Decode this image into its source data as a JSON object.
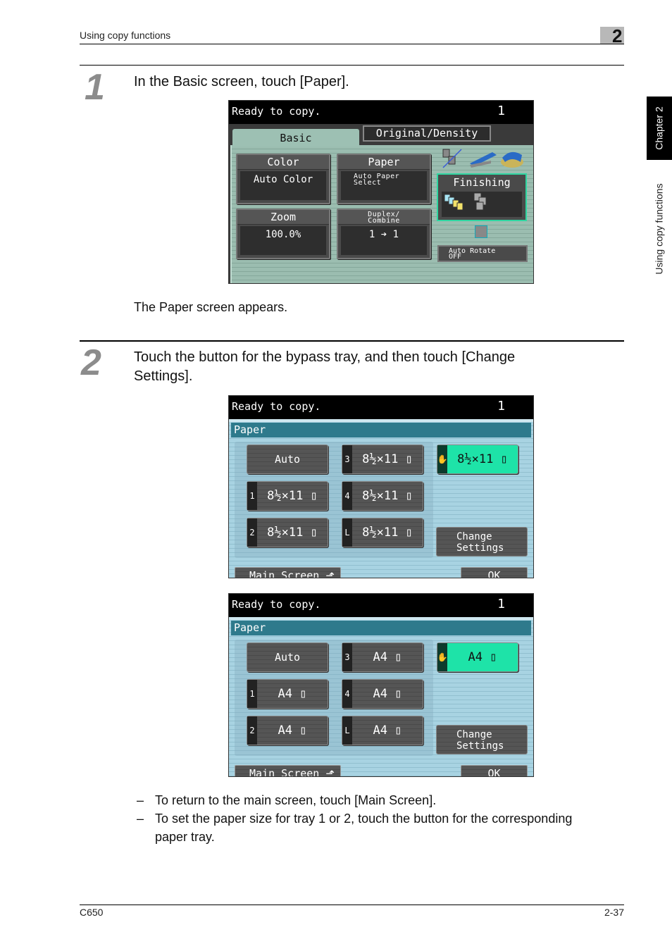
{
  "header": {
    "section_title": "Using copy functions",
    "chapter_number": "2"
  },
  "side_tab": {
    "chapter": "Chapter 2",
    "section": "Using copy functions"
  },
  "steps": [
    {
      "number": "1",
      "instruction": "In the Basic screen, touch [Paper].",
      "result": "The Paper screen appears."
    },
    {
      "number": "2",
      "instruction_line1": "Touch the button for the bypass tray, and then touch [Change",
      "instruction_line2": "Settings]."
    }
  ],
  "basic_screen": {
    "status": "Ready to copy.",
    "count": "1",
    "tabs": [
      {
        "label": "Basic",
        "active": true
      },
      {
        "label": "Original/Density",
        "active": false
      }
    ],
    "functions": [
      {
        "title": "Color",
        "value": "Auto Color"
      },
      {
        "title": "Paper",
        "value_line1": "Auto Paper",
        "value_line2": "Select"
      },
      {
        "title": "Zoom",
        "value": "100.0%"
      },
      {
        "title_line1": "Duplex/",
        "title_line2": "Combine",
        "value": "1 ➔ 1"
      }
    ],
    "finishing": {
      "title": "Finishing"
    },
    "auto_rotate": {
      "line1": "Auto Rotate",
      "line2": "OFF"
    }
  },
  "paper_screens": [
    {
      "status": "Ready to copy.",
      "count": "1",
      "title": "Paper",
      "auto_label": "Auto",
      "trays": [
        {
          "tag": "3",
          "size": "8½×11 ▯"
        },
        {
          "tag": "✋",
          "size": "8½×11 ▯",
          "selected": true
        },
        {
          "tag": "1",
          "size": "8½×11 ▯"
        },
        {
          "tag": "4",
          "size": "8½×11 ▯"
        },
        {
          "tag": "2",
          "size": "8½×11 ▯"
        },
        {
          "tag": "L",
          "size": "8½×11 ▯"
        }
      ],
      "change_settings": {
        "line1": "Change",
        "line2": "Settings"
      },
      "main_screen": "Main Screen ⬏",
      "ok": "OK"
    },
    {
      "status": "Ready to copy.",
      "count": "1",
      "title": "Paper",
      "auto_label": "Auto",
      "trays": [
        {
          "tag": "3",
          "size": "A4 ▯"
        },
        {
          "tag": "✋",
          "size": "A4 ▯",
          "selected": true
        },
        {
          "tag": "1",
          "size": "A4 ▯"
        },
        {
          "tag": "4",
          "size": "A4 ▯"
        },
        {
          "tag": "2",
          "size": "A4 ▯"
        },
        {
          "tag": "L",
          "size": "A4 ▯"
        }
      ],
      "change_settings": {
        "line1": "Change",
        "line2": "Settings"
      },
      "main_screen": "Main Screen ⬏",
      "ok": "OK"
    }
  ],
  "notes": [
    "To return to the main screen, touch [Main Screen].",
    "To set the paper size for tray 1 or 2, touch the button for the corresponding paper tray."
  ],
  "footer": {
    "model": "C650",
    "page": "2-37"
  }
}
